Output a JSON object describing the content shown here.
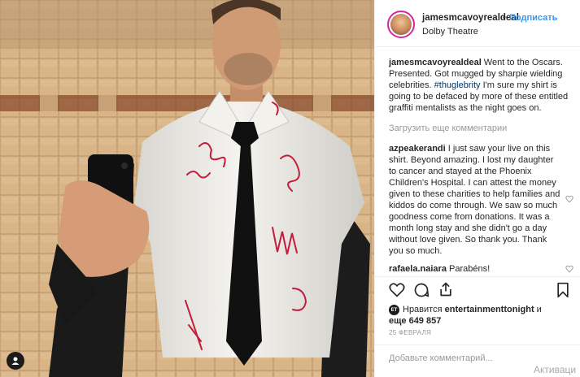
{
  "post": {
    "username": "jamesmcavoyrealdeal",
    "separator": "•",
    "follow_label": "Подписать",
    "location": "Dolby Theatre"
  },
  "caption": {
    "author": "jamesmcavoyrealdeal",
    "text_before_tag": " Went to the Oscars. Presented. Got mugged by sharpie wielding celebrities. ",
    "hashtag": "#thuglebrity",
    "text_after_tag": " I'm sure my shirt is going to be defaced by more of these entitled graffiti mentalists as the night goes on."
  },
  "load_more_label": "Загрузить еще комментарии",
  "comments": [
    {
      "author": "azpeakerandi",
      "text": " I just saw your live on this shirt. Beyond amazing. I lost my daughter to cancer and stayed at the Phoenix Children's Hospital. I can attest the money given to these charities to help families and kiddos do come through. We saw so much goodness come from donations. It was a month long stay and she didn't go a day without love given. So thank you. Thank you so much."
    },
    {
      "author": "rafaela.naiara",
      "text": " Parabéns!"
    }
  ],
  "likes": {
    "prefix": "Нравится ",
    "liked_by": "entertainmenttonight",
    "conjunction": " и",
    "count_text": "еще 649 857",
    "avatar_text": "ET"
  },
  "date": "25 ФЕВРАЛЯ",
  "add_comment_placeholder": "Добавьте комментарий...",
  "watermark": "Активаци",
  "icons": {
    "like": "heart-icon",
    "comment": "comment-icon",
    "share": "share-icon",
    "save": "bookmark-icon",
    "user_tag": "user-icon"
  },
  "colors": {
    "link": "#3897f0",
    "hashtag": "#003569",
    "muted": "#999999",
    "text": "#262626"
  }
}
